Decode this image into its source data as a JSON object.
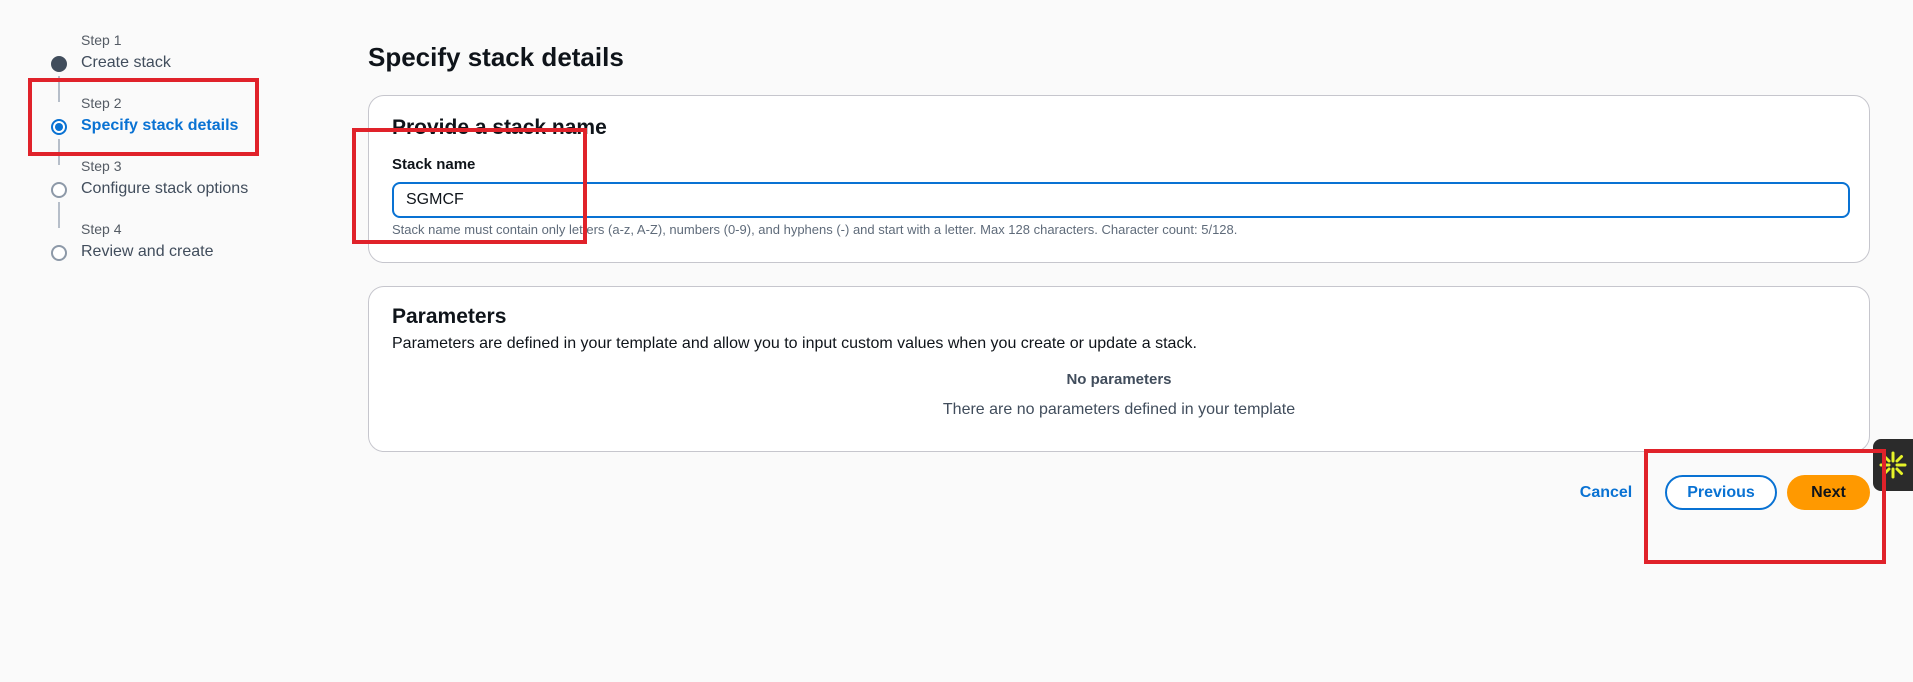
{
  "stepper": {
    "steps": [
      {
        "num": "Step 1",
        "label": "Create stack",
        "state": "done"
      },
      {
        "num": "Step 2",
        "label": "Specify stack details",
        "state": "active"
      },
      {
        "num": "Step 3",
        "label": "Configure stack options",
        "state": "pending"
      },
      {
        "num": "Step 4",
        "label": "Review and create",
        "state": "pending"
      }
    ]
  },
  "page": {
    "title": "Specify stack details"
  },
  "stack_name_section": {
    "title": "Provide a stack name",
    "field_label": "Stack name",
    "value": "SGMCF",
    "hint": "Stack name must contain only letters (a-z, A-Z), numbers (0-9), and hyphens (-) and start with a letter. Max 128 characters. Character count: 5/128."
  },
  "parameters_section": {
    "title": "Parameters",
    "description": "Parameters are defined in your template and allow you to input custom values when you create or update a stack.",
    "empty_title": "No parameters",
    "empty_description": "There are no parameters defined in your template"
  },
  "actions": {
    "cancel": "Cancel",
    "previous": "Previous",
    "next": "Next"
  },
  "colors": {
    "accent": "#0972d3",
    "primary_button": "#ff9900",
    "highlight": "#e0222a"
  },
  "icons": {
    "side_widget": "sparkle-icon"
  }
}
